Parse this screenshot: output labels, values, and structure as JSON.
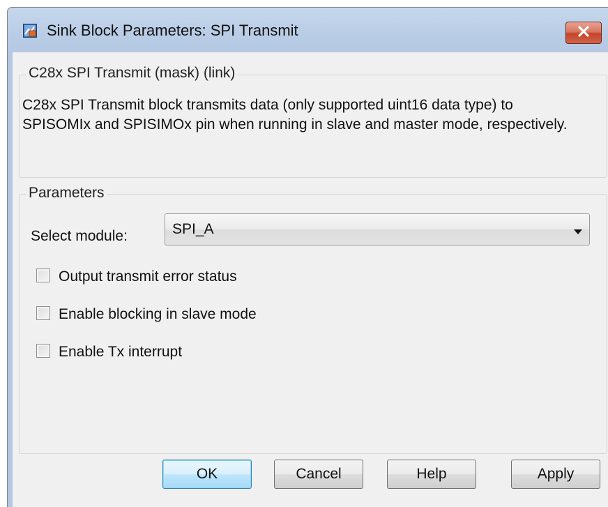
{
  "window": {
    "title": "Sink Block Parameters: SPI Transmit",
    "close_icon": "close-icon"
  },
  "description_group": {
    "legend": "C28x SPI Transmit (mask) (link)",
    "text": "C28x SPI Transmit block transmits data (only supported uint16 data type) to SPISOMIx and SPISIMOx pin when running in slave and master mode, respectively."
  },
  "parameters": {
    "legend": "Parameters",
    "module_label": "Select module:",
    "module_value": "SPI_A",
    "checkboxes": [
      {
        "label": "Output transmit error status",
        "checked": false
      },
      {
        "label": "Enable blocking in slave mode",
        "checked": false
      },
      {
        "label": "Enable Tx interrupt",
        "checked": false
      }
    ]
  },
  "buttons": {
    "ok": "OK",
    "cancel": "Cancel",
    "help": "Help",
    "apply": "Apply"
  },
  "colors": {
    "title_bar": "#b9cce5",
    "client_bg": "#f0f0f0",
    "close_button": "#c4442a",
    "default_button_border": "#3c7fb1"
  }
}
